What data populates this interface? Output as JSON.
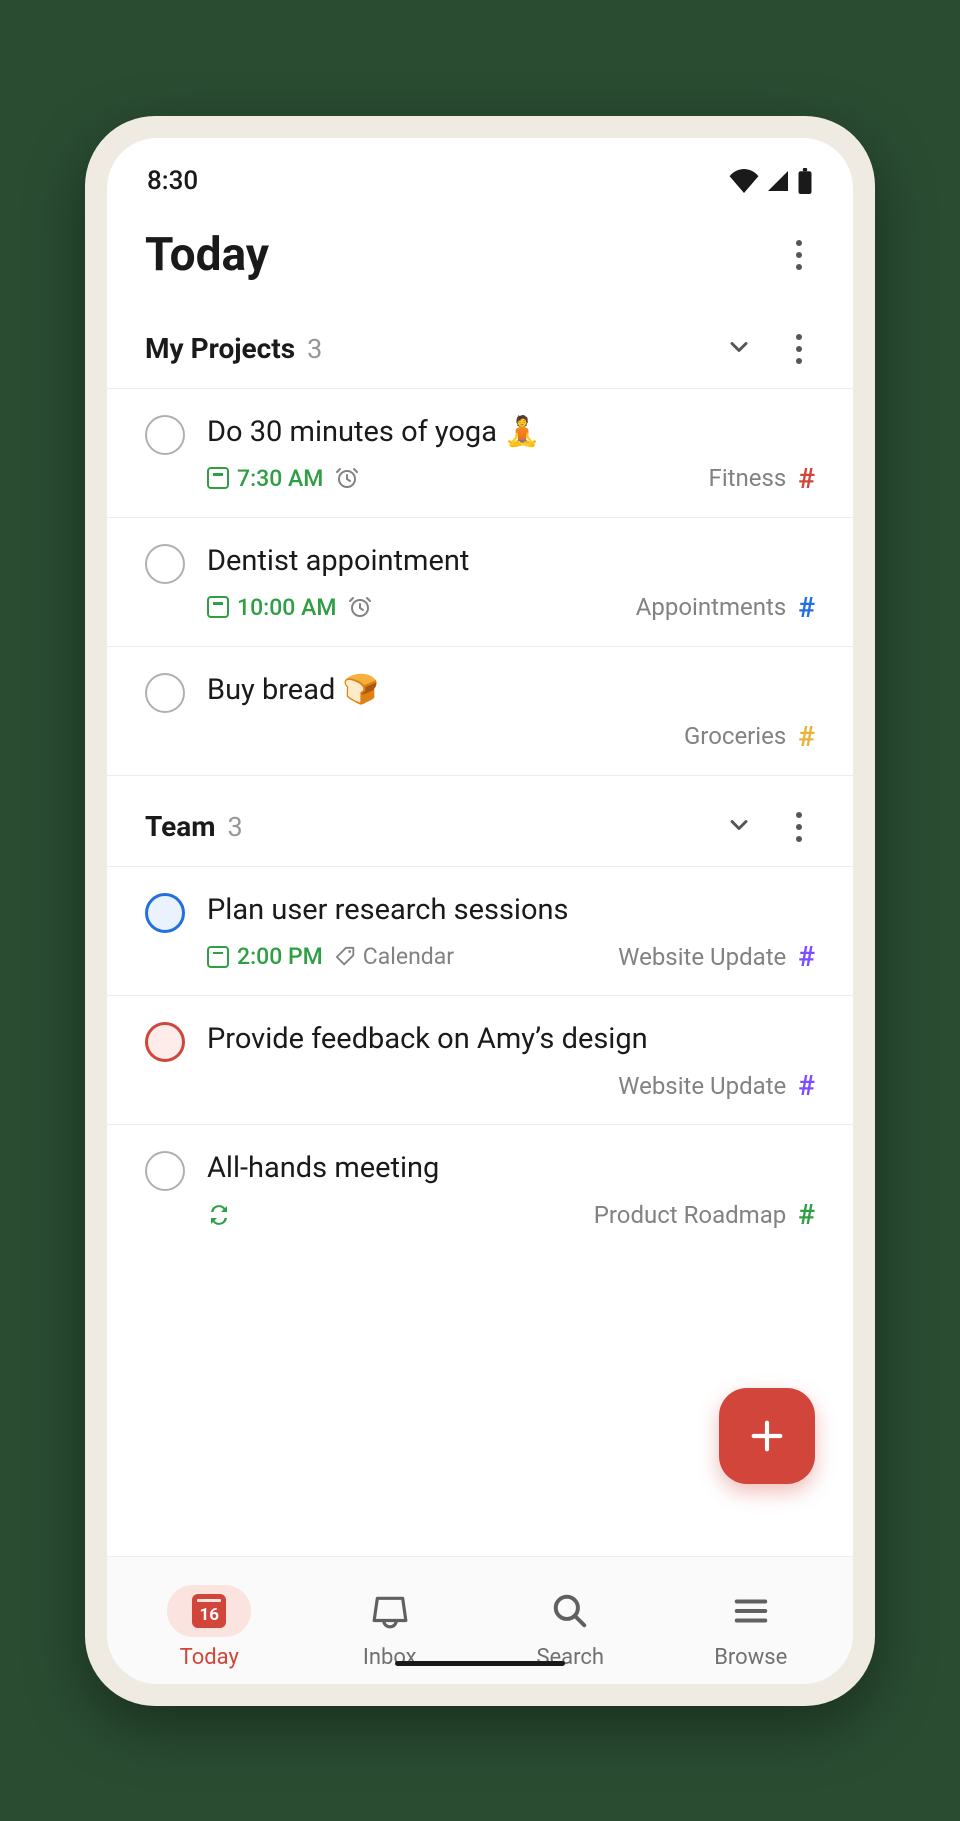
{
  "statusbar": {
    "time": "8:30"
  },
  "header": {
    "title": "Today"
  },
  "sections": [
    {
      "title": "My Projects",
      "count": "3",
      "tasks": [
        {
          "title": "Do 30 minutes of yoga 🧘",
          "time": "7:30 AM",
          "has_alarm": true,
          "label": null,
          "recurring": false,
          "project": "Fitness",
          "project_color": "red",
          "priority": "none"
        },
        {
          "title": "Dentist appointment",
          "time": "10:00 AM",
          "has_alarm": true,
          "label": null,
          "recurring": false,
          "project": "Appointments",
          "project_color": "blue",
          "priority": "none"
        },
        {
          "title": "Buy bread 🍞",
          "time": null,
          "has_alarm": false,
          "label": null,
          "recurring": false,
          "project": "Groceries",
          "project_color": "yellow",
          "priority": "none"
        }
      ]
    },
    {
      "title": "Team",
      "count": "3",
      "tasks": [
        {
          "title": "Plan user research sessions",
          "time": "2:00 PM",
          "has_alarm": false,
          "label": "Calendar",
          "recurring": false,
          "project": "Website Update",
          "project_color": "purple",
          "priority": "blue"
        },
        {
          "title": "Provide feedback on Amy’s design",
          "time": null,
          "has_alarm": false,
          "label": null,
          "recurring": false,
          "project": "Website Update",
          "project_color": "purple",
          "priority": "red"
        },
        {
          "title": "All-hands meeting",
          "time": null,
          "has_alarm": false,
          "label": null,
          "recurring": true,
          "project": "Product Roadmap",
          "project_color": "green",
          "priority": "none"
        }
      ]
    }
  ],
  "nav": {
    "today": {
      "label": "Today",
      "date": "16"
    },
    "inbox": {
      "label": "Inbox"
    },
    "search": {
      "label": "Search"
    },
    "browse": {
      "label": "Browse"
    }
  }
}
